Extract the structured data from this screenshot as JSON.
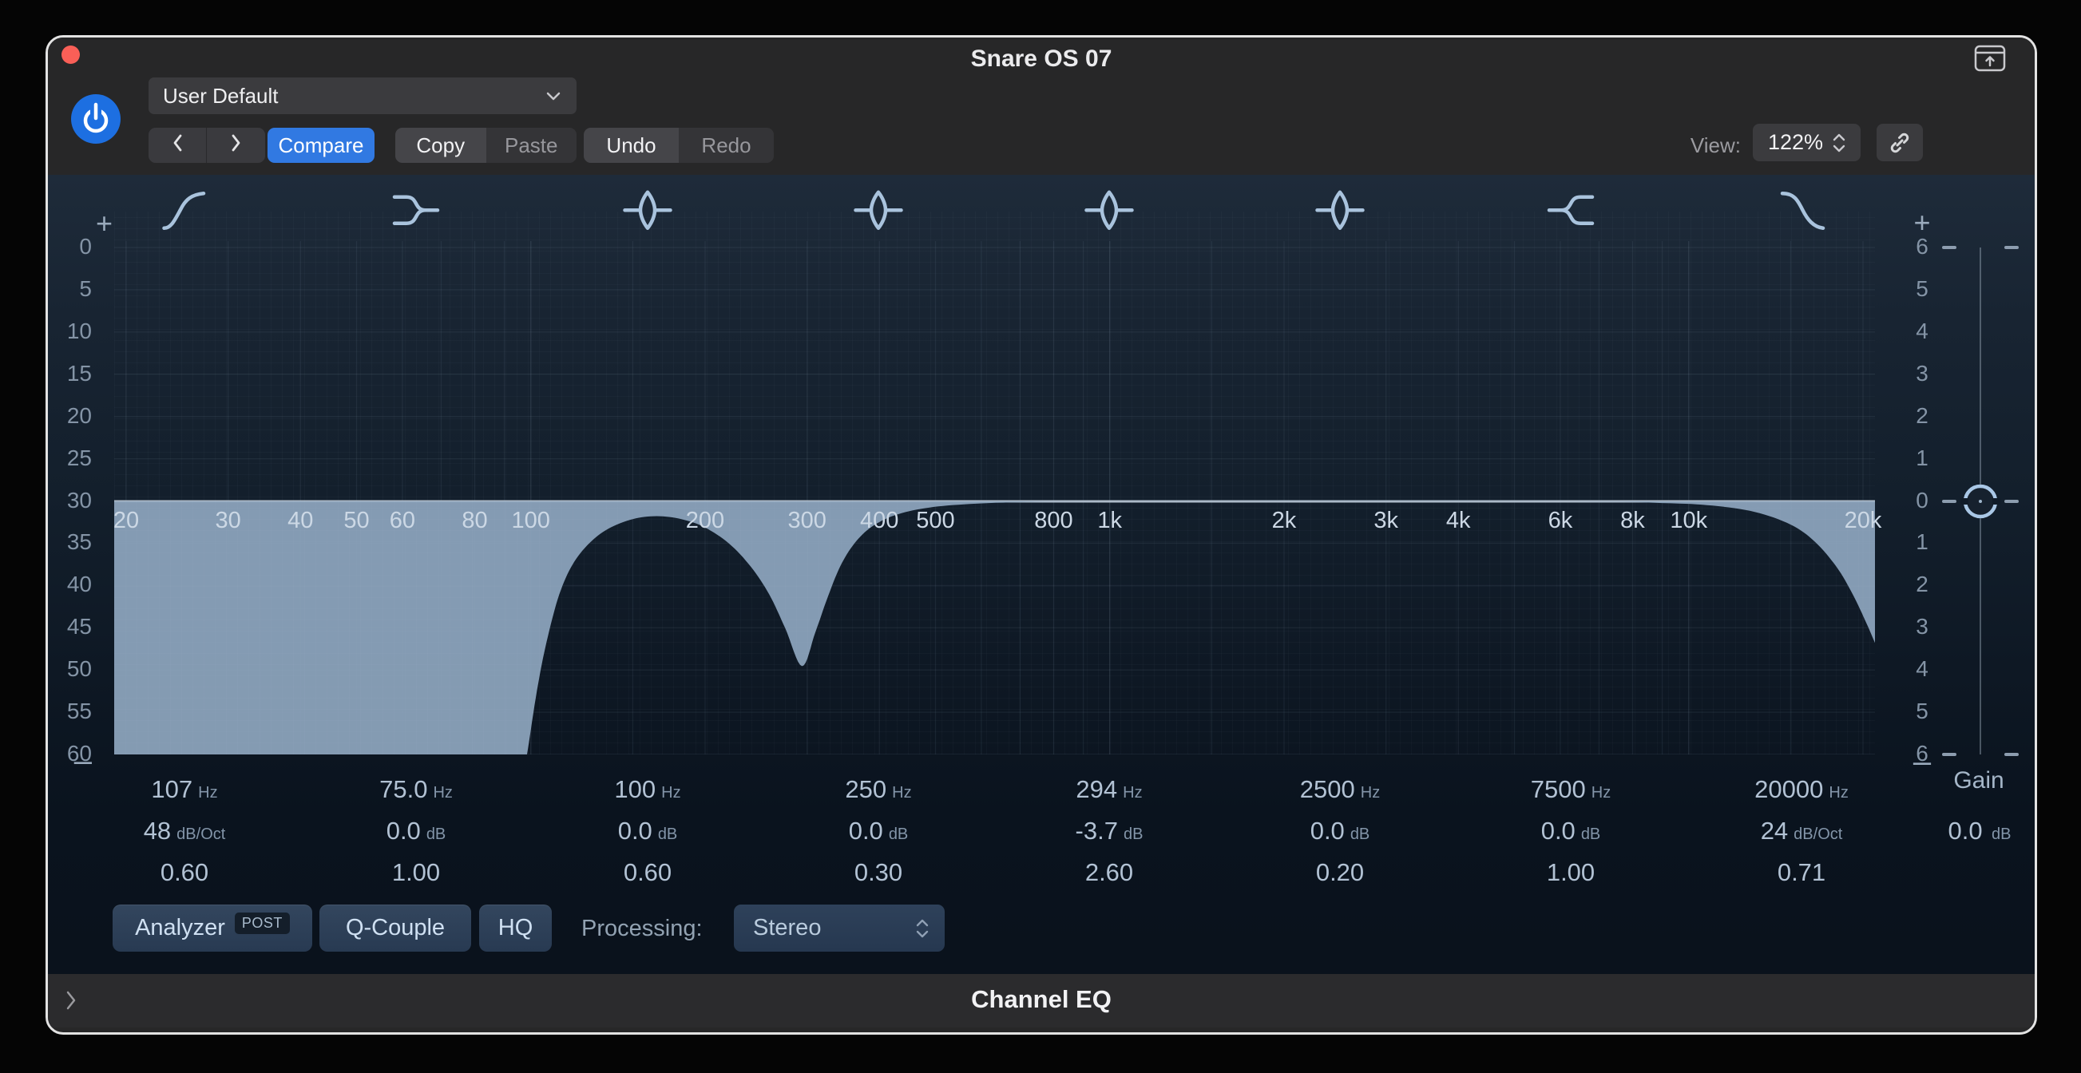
{
  "window": {
    "title": "Snare OS 07"
  },
  "header": {
    "preset": "User Default",
    "compare": "Compare",
    "copy": "Copy",
    "paste": "Paste",
    "undo": "Undo",
    "redo": "Redo",
    "view_label": "View:",
    "view_value": "122%"
  },
  "eq": {
    "analyzer_scale": [
      "0",
      "5",
      "10",
      "15",
      "20",
      "25",
      "30",
      "35",
      "40",
      "45",
      "50",
      "55",
      "60"
    ],
    "gain_scale": [
      "6",
      "5",
      "4",
      "3",
      "2",
      "1",
      "0",
      "1",
      "2",
      "3",
      "4",
      "5",
      "6"
    ],
    "plus": "+",
    "minus": "–",
    "freq_ticks": [
      {
        "f": 20,
        "label": "20"
      },
      {
        "f": 30,
        "label": "30"
      },
      {
        "f": 40,
        "label": "40"
      },
      {
        "f": 50,
        "label": "50"
      },
      {
        "f": 60,
        "label": "60"
      },
      {
        "f": 80,
        "label": "80"
      },
      {
        "f": 100,
        "label": "100"
      },
      {
        "f": 200,
        "label": "200"
      },
      {
        "f": 300,
        "label": "300"
      },
      {
        "f": 400,
        "label": "400"
      },
      {
        "f": 500,
        "label": "500"
      },
      {
        "f": 800,
        "label": "800"
      },
      {
        "f": 1000,
        "label": "1k"
      },
      {
        "f": 2000,
        "label": "2k"
      },
      {
        "f": 3000,
        "label": "3k"
      },
      {
        "f": 4000,
        "label": "4k"
      },
      {
        "f": 6000,
        "label": "6k"
      },
      {
        "f": 8000,
        "label": "8k"
      },
      {
        "f": 10000,
        "label": "10k"
      },
      {
        "f": 20000,
        "label": "20k"
      }
    ],
    "grid_freqs": [
      20,
      30,
      40,
      50,
      60,
      70,
      80,
      90,
      100,
      150,
      200,
      300,
      400,
      500,
      600,
      700,
      800,
      900,
      1000,
      1500,
      2000,
      3000,
      4000,
      5000,
      6000,
      7000,
      8000,
      9000,
      10000,
      15000,
      20000
    ],
    "bands": [
      {
        "type": "highpass",
        "freq": "107",
        "freq_unit": "Hz",
        "gain": "48",
        "gain_unit": "dB/Oct",
        "q": "0.60"
      },
      {
        "type": "low-shelf",
        "freq": "75.0",
        "freq_unit": "Hz",
        "gain": "0.0",
        "gain_unit": "dB",
        "q": "1.00"
      },
      {
        "type": "bell",
        "freq": "100",
        "freq_unit": "Hz",
        "gain": "0.0",
        "gain_unit": "dB",
        "q": "0.60"
      },
      {
        "type": "bell",
        "freq": "250",
        "freq_unit": "Hz",
        "gain": "0.0",
        "gain_unit": "dB",
        "q": "0.30"
      },
      {
        "type": "bell",
        "freq": "294",
        "freq_unit": "Hz",
        "gain": "-3.7",
        "gain_unit": "dB",
        "q": "2.60"
      },
      {
        "type": "bell",
        "freq": "2500",
        "freq_unit": "Hz",
        "gain": "0.0",
        "gain_unit": "dB",
        "q": "0.20"
      },
      {
        "type": "high-shelf",
        "freq": "7500",
        "freq_unit": "Hz",
        "gain": "0.0",
        "gain_unit": "dB",
        "q": "1.00"
      },
      {
        "type": "lowpass",
        "freq": "20000",
        "freq_unit": "Hz",
        "gain": "24",
        "gain_unit": "dB/Oct",
        "q": "0.71"
      }
    ],
    "master_gain": {
      "label": "Gain",
      "value": "0.0",
      "unit": "dB"
    },
    "curve_points": [
      [
        19,
        -40
      ],
      [
        80,
        -22
      ],
      [
        90,
        -11
      ],
      [
        95,
        -7.5
      ],
      [
        99,
        -5.8
      ],
      [
        103,
        -4.3
      ],
      [
        107,
        -3.2
      ],
      [
        112,
        -2.2
      ],
      [
        118,
        -1.5
      ],
      [
        126,
        -1.0
      ],
      [
        136,
        -0.65
      ],
      [
        150,
        -0.42
      ],
      [
        165,
        -0.35
      ],
      [
        182,
        -0.42
      ],
      [
        200,
        -0.62
      ],
      [
        220,
        -1.0
      ],
      [
        240,
        -1.55
      ],
      [
        258,
        -2.2
      ],
      [
        275,
        -3.0
      ],
      [
        294,
        -3.9
      ],
      [
        310,
        -3.1
      ],
      [
        325,
        -2.3
      ],
      [
        342,
        -1.55
      ],
      [
        362,
        -1.0
      ],
      [
        388,
        -0.6
      ],
      [
        425,
        -0.33
      ],
      [
        480,
        -0.16
      ],
      [
        560,
        -0.07
      ],
      [
        700,
        -0.02
      ],
      [
        1000,
        0
      ],
      [
        6000,
        0
      ],
      [
        9000,
        -0.04
      ],
      [
        11000,
        -0.1
      ],
      [
        13000,
        -0.25
      ],
      [
        15000,
        -0.55
      ],
      [
        16500,
        -0.95
      ],
      [
        18000,
        -1.55
      ],
      [
        19200,
        -2.2
      ],
      [
        20300,
        -2.9
      ],
      [
        21200,
        -3.5
      ]
    ]
  },
  "controls": {
    "analyzer": "Analyzer",
    "analyzer_mode": "POST",
    "q_couple": "Q-Couple",
    "hq": "HQ",
    "processing_label": "Processing:",
    "processing_value": "Stereo"
  },
  "footer": {
    "title": "Channel EQ"
  },
  "colors": {
    "accent_blue": "#3179e2",
    "power_blue": "#1d6fe1",
    "close_red": "#f95f57",
    "curve_fill": "#8ba2ba",
    "zero_line": "#b6c4d2",
    "grid_line": "#9fb4c8"
  }
}
